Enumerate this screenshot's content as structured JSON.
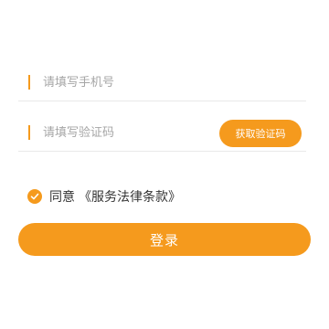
{
  "form": {
    "phone": {
      "placeholder": "请填写手机号",
      "value": ""
    },
    "code": {
      "placeholder": "请填写验证码",
      "value": "",
      "get_code_label": "获取验证码"
    }
  },
  "agreement": {
    "checked": true,
    "prefix": "同意",
    "terms_label": "《服务法律条款》"
  },
  "login_label": "登录",
  "colors": {
    "accent": "#f59a1d",
    "divider": "#e9e9e9",
    "placeholder": "#a6a6a6"
  }
}
